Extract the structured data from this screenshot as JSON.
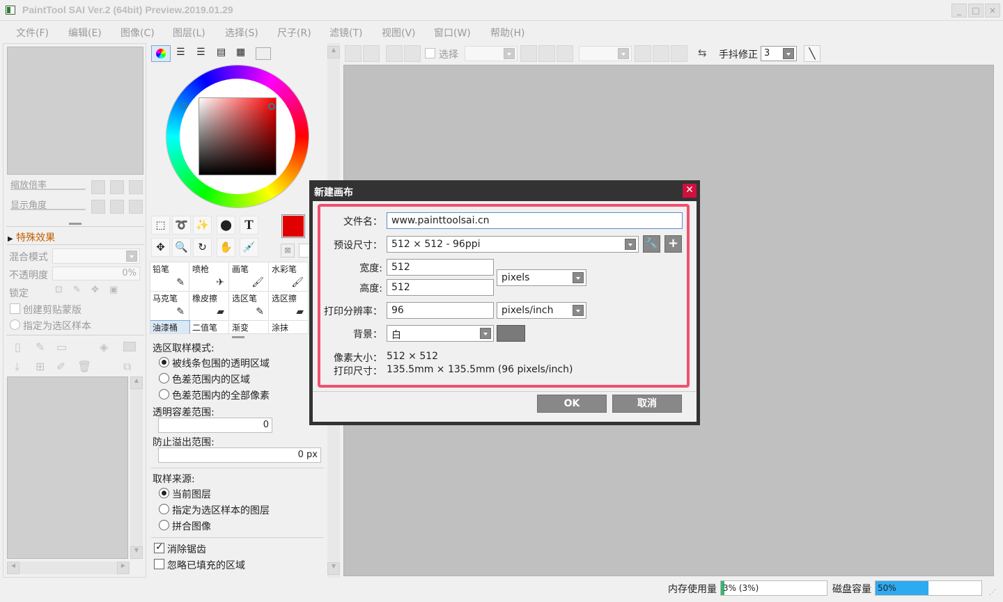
{
  "window": {
    "title": "PaintTool SAI Ver.2 (64bit) Preview.2019.01.29",
    "minimize": "_",
    "maximize": "□",
    "close": "×"
  },
  "menu": [
    "文件(F)",
    "编辑(E)",
    "图像(C)",
    "图层(L)",
    "选择(S)",
    "尺子(R)",
    "滤镜(T)",
    "视图(V)",
    "窗口(W)",
    "帮助(H)"
  ],
  "navigator": {
    "zoom_label": "缩放倍率",
    "angle_label": "显示角度"
  },
  "layer_panel": {
    "effects_label": "特殊效果",
    "blend_mode_label": "混合模式",
    "opacity_label": "不透明度",
    "opacity_value": "0%",
    "lock_label": "锁定",
    "clipping_label": "创建剪贴蒙版",
    "selection_source_label": "指定为选区样本"
  },
  "tools": {
    "text_tool": "T",
    "primary_color": "#e00000"
  },
  "brushes": [
    {
      "label": "铅笔",
      "icon": "pencil-icon"
    },
    {
      "label": "喷枪",
      "icon": "airbrush-icon"
    },
    {
      "label": "画笔",
      "icon": "brush-icon"
    },
    {
      "label": "水彩笔",
      "icon": "watercolor-icon"
    },
    {
      "label": "马克笔",
      "icon": "marker-icon"
    },
    {
      "label": "橡皮擦",
      "icon": "eraser-icon"
    },
    {
      "label": "选区笔",
      "icon": "select-pen-icon"
    },
    {
      "label": "选区擦",
      "icon": "select-eraser-icon"
    },
    {
      "label": "油漆桶",
      "icon": "bucket-icon"
    },
    {
      "label": "二值笔",
      "icon": "binary-pen-icon"
    },
    {
      "label": "渐变",
      "icon": "gradient-icon"
    },
    {
      "label": "涂抹",
      "icon": "smudge-icon"
    }
  ],
  "fill_options": {
    "mode_label": "选区取样模式:",
    "mode_options": [
      "被线条包围的透明区域",
      "色差范围内的区域",
      "色差范围内的全部像素"
    ],
    "tolerance_label": "透明容差范围:",
    "tolerance_value": "0",
    "overflow_label": "防止溢出范围:",
    "overflow_value": "0 px",
    "source_label": "取样来源:",
    "source_options": [
      "当前图层",
      "指定为选区样本的图层",
      "拼合图像"
    ],
    "antialias_label": "消除锯齿",
    "ignore_filled_label": "忽略已填充的区域"
  },
  "toolbar": {
    "select_label": "选择",
    "stabilizer_label": "手抖修正",
    "stabilizer_value": "3"
  },
  "dialog": {
    "title": "新建画布",
    "filename_label": "文件名：",
    "filename_value": "www.painttoolsai.cn",
    "preset_label": "预设尺寸：",
    "preset_value": "512 × 512 - 96ppi",
    "width_label": "宽度:",
    "width_value": "512",
    "height_label": "高度:",
    "height_value": "512",
    "unit_value": "pixels",
    "resolution_label": "打印分辨率：",
    "resolution_value": "96",
    "resolution_unit": "pixels/inch",
    "background_label": "背景：",
    "background_value": "白",
    "pixel_size_label": "像素大小：",
    "pixel_size_value": "512 × 512",
    "print_size_label": "打印尺寸：",
    "print_size_value": "135.5mm × 135.5mm (96 pixels/inch)",
    "ok_label": "OK",
    "cancel_label": "取消",
    "highlight_color": "#f0506e"
  },
  "statusbar": {
    "memory_label": "内存使用量",
    "memory_value": "3% (3%)",
    "memory_fraction": 0.03,
    "disk_label": "磁盘容量",
    "disk_value": "50%",
    "disk_fraction": 0.5
  }
}
